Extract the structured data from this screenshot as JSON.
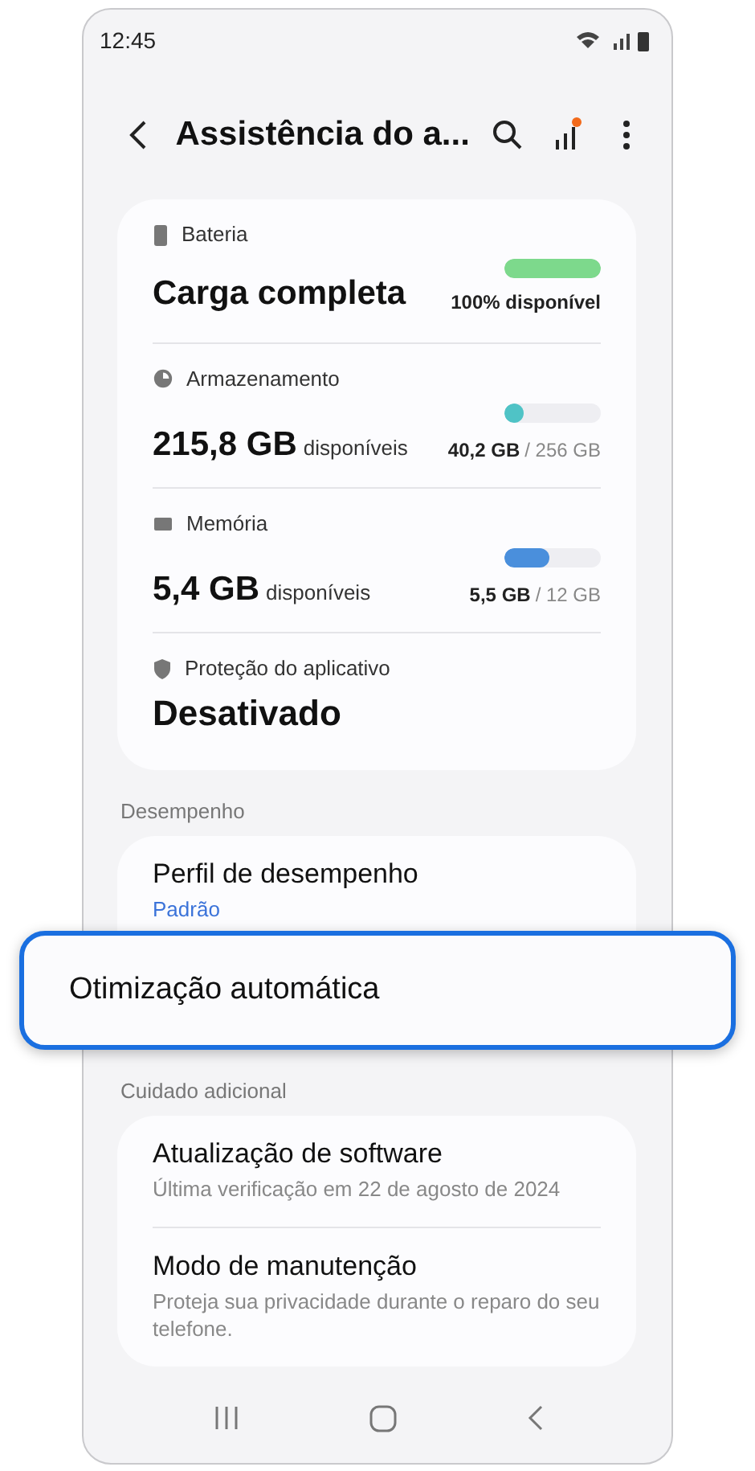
{
  "status_bar": {
    "time": "12:45"
  },
  "header": {
    "title": "Assistência do a...",
    "notification_dot": true
  },
  "summary": [
    {
      "kind": "battery",
      "label": "Bateria",
      "value": "Carga completa",
      "level": 1,
      "color": "#7dd98c",
      "reading": "100% disponível"
    },
    {
      "kind": "storage",
      "label": "Armazenamento",
      "value": "215,8 GB",
      "unit": "disponíveis",
      "level": 0.16,
      "color": "#4fc3c6",
      "used": "40,2 GB",
      "total": "/ 256 GB"
    },
    {
      "kind": "memory",
      "label": "Memória",
      "value": "5,4 GB",
      "unit": "disponíveis",
      "level": 0.46,
      "color": "#4a8fdc",
      "used": "5,5 GB",
      "total": "/ 12 GB"
    },
    {
      "kind": "protection",
      "label": "Proteção do aplicativo",
      "value": "Desativado"
    }
  ],
  "sections": [
    {
      "title": "Desempenho",
      "items": [
        {
          "title": "Perfil de desempenho",
          "value": "Padrão"
        }
      ]
    },
    {
      "title": "Cuidado adicional",
      "items": [
        {
          "title": "Atualização de software",
          "subtitle": "Última verificação em 22 de agosto de 2024"
        },
        {
          "title": "Modo de manutenção",
          "subtitle": "Proteja sua privacidade durante o reparo do seu telefone."
        }
      ]
    }
  ],
  "highlight": {
    "title": "Otimização automática"
  }
}
